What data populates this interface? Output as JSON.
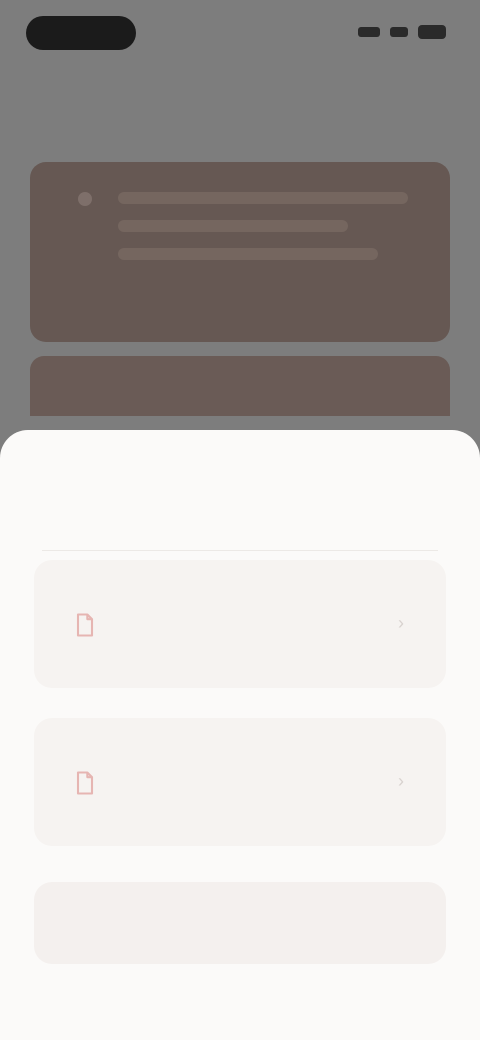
{
  "status_bar": {
    "time": "",
    "icons": [
      "signal-icon",
      "wifi-icon",
      "battery-icon"
    ]
  },
  "background": {
    "header": "",
    "header_sub": ""
  },
  "sheet": {
    "title": "",
    "title_accent": "",
    "options": [
      {
        "id": "option-1",
        "icon": "document-icon",
        "title": "",
        "description": ""
      },
      {
        "id": "option-2",
        "icon": "document-icon",
        "title": "",
        "description": ""
      }
    ],
    "primary_button": ""
  },
  "colors": {
    "scrim": "#7d7d7d",
    "sheet_bg": "#fbfaf9",
    "card_bg": "#665853",
    "icon_accent": "#e6b5b2"
  }
}
